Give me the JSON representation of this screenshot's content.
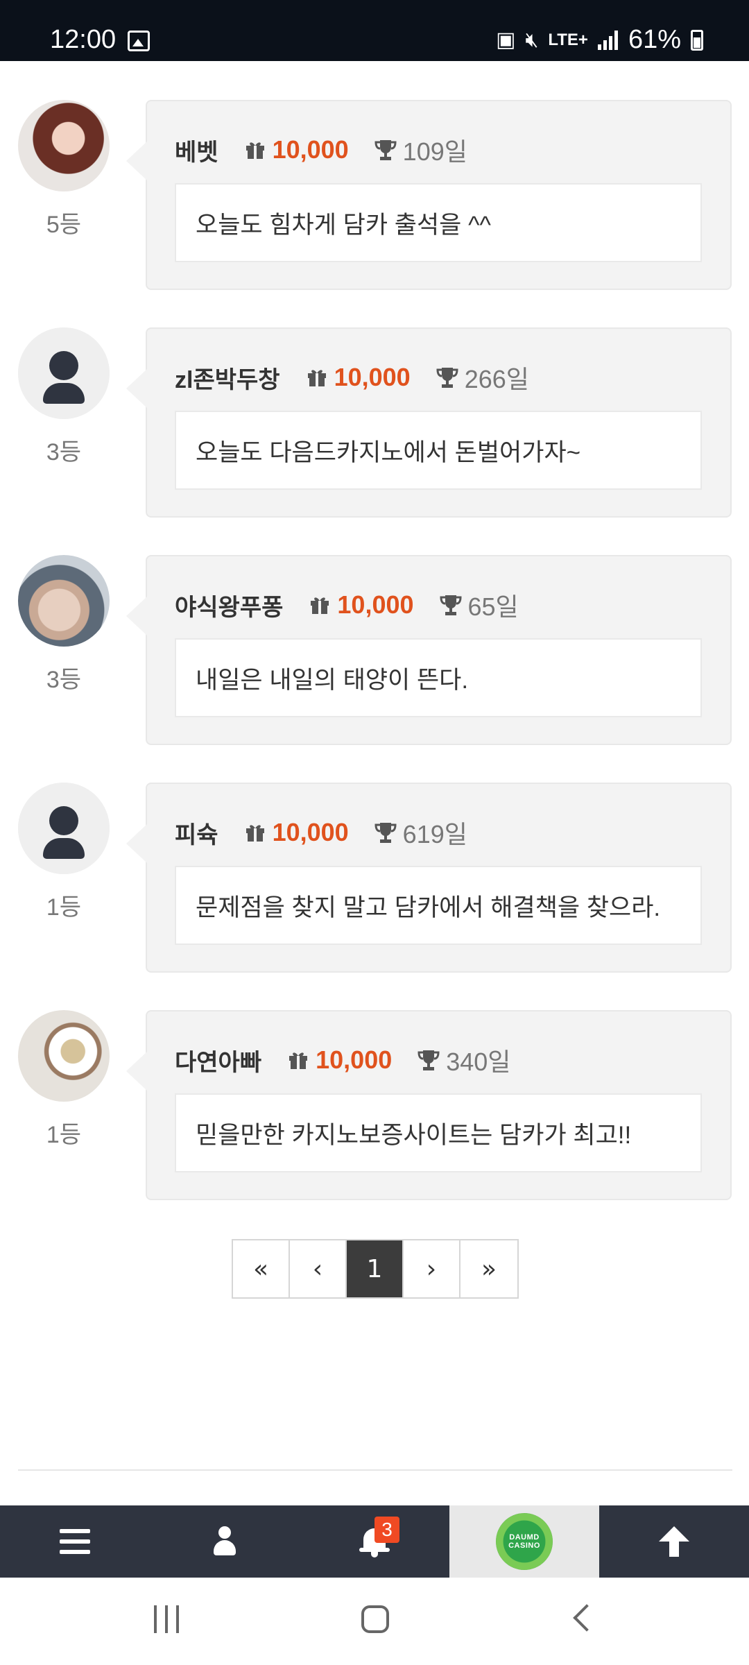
{
  "status_bar": {
    "time": "12:00",
    "network": "LTE+",
    "battery": "61%"
  },
  "comments": [
    {
      "nick": "베벳",
      "points": "10,000",
      "days": "109일",
      "rank": "5등",
      "message": "오늘도 힘차게 담카 출석을 ^^",
      "avatar": "photo"
    },
    {
      "nick": "zl존박두창",
      "points": "10,000",
      "days": "266일",
      "rank": "3등",
      "message": "오늘도 다음드카지노에서 돈벌어가자~",
      "avatar": "default-person"
    },
    {
      "nick": "야식왕푸퐁",
      "points": "10,000",
      "days": "65일",
      "rank": "3등",
      "message": "내일은 내일의 태양이 뜬다.",
      "avatar": "photo"
    },
    {
      "nick": "피슉",
      "points": "10,000",
      "days": "619일",
      "rank": "1등",
      "message": "문제점을 찾지 말고 담카에서 해결책을 찾으라.",
      "avatar": "default-person"
    },
    {
      "nick": "다연아빠",
      "points": "10,000",
      "days": "340일",
      "rank": "1등",
      "message": "믿을만한 카지노보증사이트는 담카가 최고!!",
      "avatar": "photo"
    }
  ],
  "pagination": {
    "first": "«",
    "prev": "‹",
    "current": "1",
    "next": "›",
    "last": "»"
  },
  "bottom_nav": {
    "notification_count": "3",
    "logo_line1": "DAUMD",
    "logo_line2": "CASINO"
  },
  "colors": {
    "points": "#e0521d",
    "nav_bg": "#2f3440",
    "badge": "#f04a23",
    "active_page": "#3c3c3c"
  }
}
